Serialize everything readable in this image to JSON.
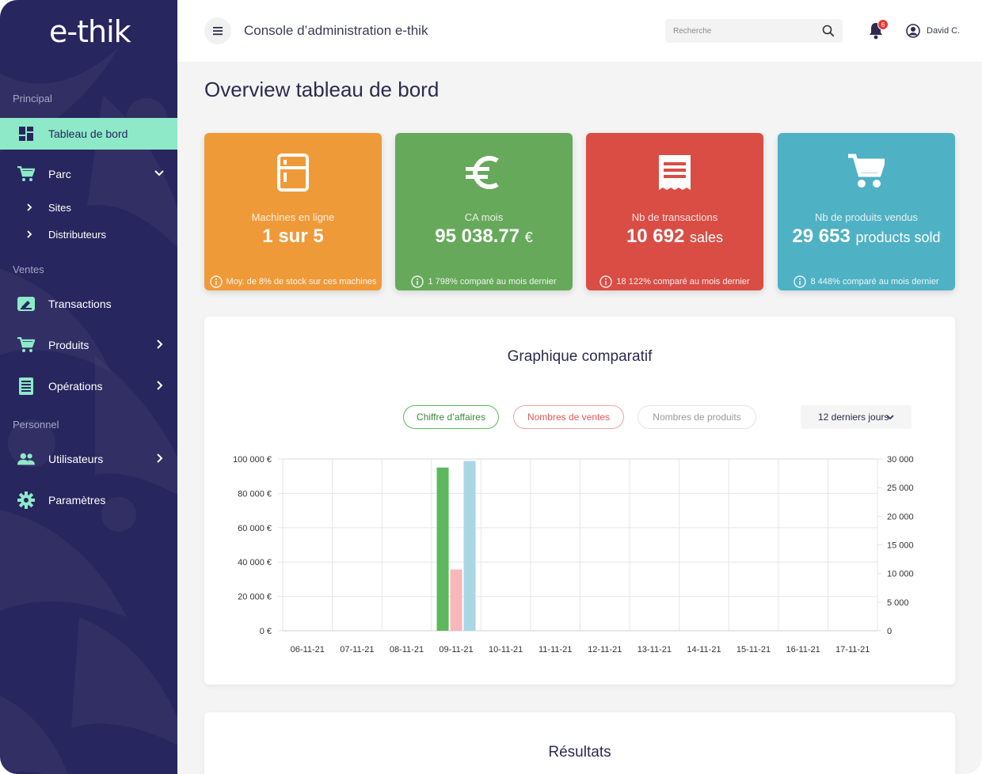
{
  "brand": {
    "logo_text": "e-thik"
  },
  "sidebar": {
    "sections": {
      "principal": "Principal",
      "ventes": "Ventes",
      "personnel": "Personnel"
    },
    "items": {
      "tableau": "Tableau de bord",
      "parc": "Parc",
      "sites": "Sites",
      "distributeurs": "Distributeurs",
      "transactions": "Transactions",
      "produits": "Produits",
      "operations": "Opérations",
      "utilisateurs": "Utilisateurs",
      "parametres": "Paramètres"
    }
  },
  "header": {
    "title": "Console d’administration e-thik",
    "search_placeholder": "Recherche",
    "notification_count": "6",
    "user_name": "David C."
  },
  "page": {
    "title": "Overview tableau de bord"
  },
  "cards": [
    {
      "label": "Machines en ligne",
      "value": "1 sur 5",
      "unit": "",
      "footer": "Moy. de 8% de stock sur ces machines",
      "color": "#ef9a38",
      "icon": "fridge-icon"
    },
    {
      "label": "CA mois",
      "value": "95 038.77",
      "unit": "€",
      "footer": "1 798% comparé au mois dernier",
      "color": "#66a95a",
      "icon": "euro-icon"
    },
    {
      "label": "Nb de transactions",
      "value": "10 692",
      "unit": "sales",
      "footer": "18 122% comparé au mois dernier",
      "color": "#d94d45",
      "icon": "receipt-icon"
    },
    {
      "label": "Nb de produits vendus",
      "value": "29 653",
      "unit": "products sold",
      "footer": "8 448% comparé au mois dernier",
      "color": "#4fb1c4",
      "icon": "cart-icon"
    }
  ],
  "chart_panel": {
    "title": "Graphique comparatif",
    "filters": [
      "Chiffre d’affaires",
      "Nombres de ventes",
      "Nombres de produits"
    ],
    "period": "12 derniers jours"
  },
  "results_panel": {
    "title": "Résultats"
  },
  "colors": {
    "sidebar": "#28265e",
    "active": "#8de9c8",
    "green": "#5cb85c",
    "pink": "#f7b7bb",
    "blue": "#a9d6e5"
  },
  "chart_data": {
    "type": "bar",
    "categories": [
      "06-11-21",
      "07-11-21",
      "08-11-21",
      "09-11-21",
      "10-11-21",
      "11-11-21",
      "12-11-21",
      "13-11-21",
      "14-11-21",
      "15-11-21",
      "16-11-21",
      "17-11-21"
    ],
    "y_left": {
      "ticks": [
        "0 €",
        "20 000 €",
        "40 000 €",
        "60 000 €",
        "80 000 €",
        "100 000 €"
      ],
      "ylim": [
        0,
        100000
      ]
    },
    "y_right": {
      "ticks": [
        "0",
        "5 000",
        "10 000",
        "15 000",
        "20 000",
        "25 000",
        "30 000"
      ],
      "ylim": [
        0,
        30000
      ]
    },
    "series": [
      {
        "color": "#5cb85c",
        "axis": "left",
        "values": [
          0,
          0,
          0,
          95038,
          0,
          0,
          0,
          0,
          0,
          0,
          0,
          0
        ]
      },
      {
        "color": "#f7b7bb",
        "axis": "right",
        "values": [
          0,
          0,
          0,
          10692,
          0,
          0,
          0,
          0,
          0,
          0,
          0,
          0
        ]
      },
      {
        "color": "#a9d6e5",
        "axis": "right",
        "values": [
          0,
          0,
          0,
          29653,
          0,
          0,
          0,
          0,
          0,
          0,
          0,
          0
        ]
      }
    ],
    "grid": true
  }
}
